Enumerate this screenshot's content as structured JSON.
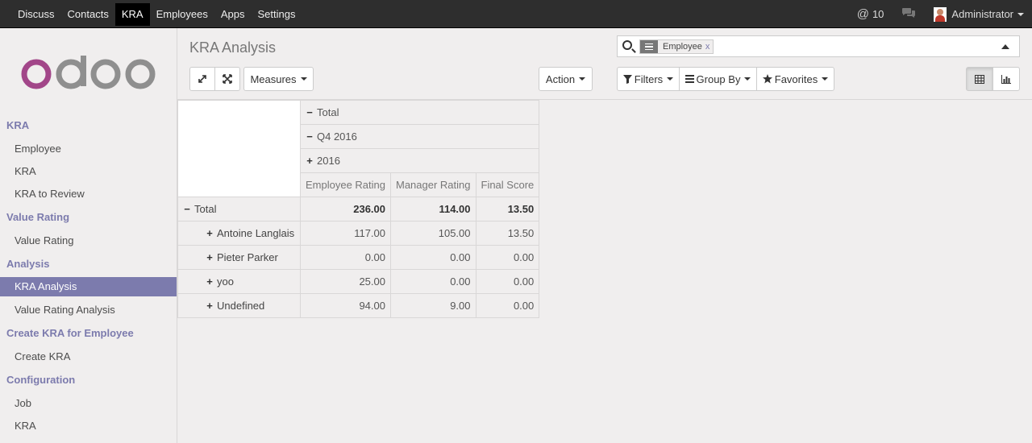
{
  "topbar": {
    "menu": [
      "Discuss",
      "Contacts",
      "KRA",
      "Employees",
      "Apps",
      "Settings"
    ],
    "active": "KRA",
    "notifications": "10",
    "user": "Administrator"
  },
  "brand": {
    "logo_text": "odoo",
    "logo_color": "#a24689"
  },
  "sidebar": {
    "sections": [
      {
        "title": "KRA",
        "items": [
          "Employee",
          "KRA",
          "KRA to Review"
        ]
      },
      {
        "title": "Value Rating",
        "items": [
          "Value Rating"
        ]
      },
      {
        "title": "Analysis",
        "items": [
          "KRA Analysis",
          "Value Rating Analysis"
        ]
      },
      {
        "title": "Create KRA for Employee",
        "items": [
          "Create KRA"
        ]
      },
      {
        "title": "Configuration",
        "items": [
          "Job",
          "KRA"
        ]
      }
    ],
    "active_item": "KRA Analysis"
  },
  "control": {
    "title": "KRA Analysis",
    "measures_label": "Measures",
    "action_label": "Action",
    "filters_label": "Filters",
    "groupby_label": "Group By",
    "favorites_label": "Favorites",
    "search_facet": "Employee",
    "facet_remove": "x"
  },
  "pivot": {
    "col_headers": [
      "Total",
      "Q4 2016",
      "2016"
    ],
    "measures": [
      "Employee Rating",
      "Manager Rating",
      "Final Score"
    ],
    "total_label": "Total",
    "total_values": [
      "236.00",
      "114.00",
      "13.50"
    ],
    "rows": [
      {
        "label": "Antoine Langlais",
        "values": [
          "117.00",
          "105.00",
          "13.50"
        ]
      },
      {
        "label": "Pieter Parker",
        "values": [
          "0.00",
          "0.00",
          "0.00"
        ]
      },
      {
        "label": "yoo",
        "values": [
          "25.00",
          "0.00",
          "0.00"
        ]
      },
      {
        "label": "Undefined",
        "values": [
          "94.00",
          "9.00",
          "0.00"
        ]
      }
    ]
  }
}
